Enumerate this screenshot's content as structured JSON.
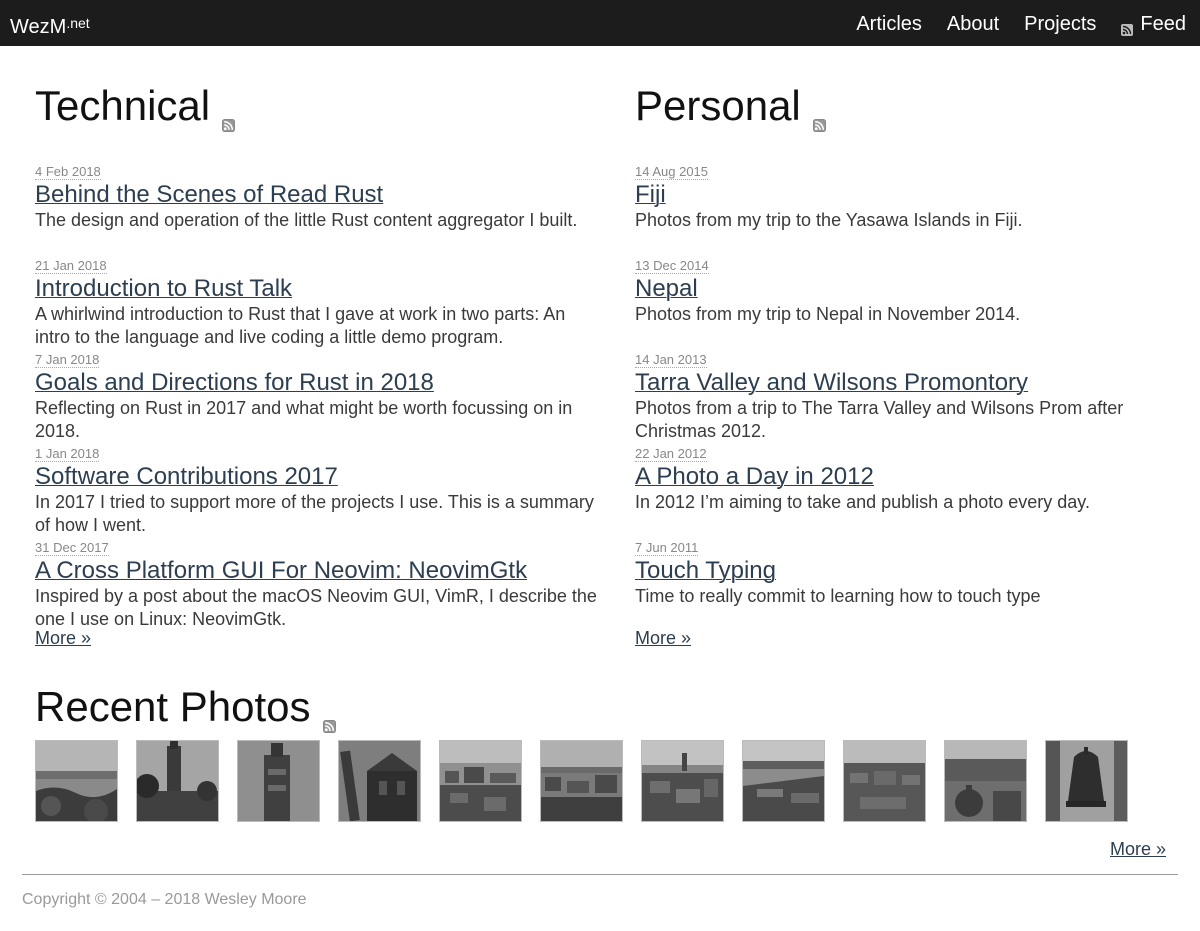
{
  "header": {
    "brand": "WezM",
    "brand_sup": ".net",
    "nav": [
      {
        "label": "Articles"
      },
      {
        "label": "About"
      },
      {
        "label": "Projects"
      },
      {
        "label": "Feed",
        "icon": "rss-icon"
      }
    ]
  },
  "technical": {
    "title": "Technical",
    "icon": "rss-icon",
    "items": [
      {
        "date": "4 Feb 2018",
        "title": "Behind the Scenes of Read Rust",
        "desc": "The design and operation of the little Rust content aggregator I built."
      },
      {
        "date": "21 Jan 2018",
        "title": "Introduction to Rust Talk",
        "desc": "A whirlwind introduction to Rust that I gave at work in two parts: An intro to the language and live coding a little demo program."
      },
      {
        "date": "7 Jan 2018",
        "title": "Goals and Directions for Rust in 2018",
        "desc": "Reflecting on Rust in 2017 and what might be worth focussing on in 2018."
      },
      {
        "date": "1 Jan 2018",
        "title": "Software Contributions 2017",
        "desc": "In 2017 I tried to support more of the projects I use. This is a summary of how I went."
      },
      {
        "date": "31 Dec 2017",
        "title": "A Cross Platform GUI For Neovim: NeovimGtk",
        "desc": "Inspired by a post about the macOS Neovim GUI, VimR, I describe the one I use on Linux: NeovimGtk."
      }
    ],
    "more": "More »"
  },
  "personal": {
    "title": "Personal",
    "icon": "rss-icon",
    "items": [
      {
        "date": "14 Aug 2015",
        "title": "Fiji",
        "desc": "Photos from my trip to the Yasawa Islands in Fiji."
      },
      {
        "date": "13 Dec 2014",
        "title": "Nepal",
        "desc": "Photos from my trip to Nepal in November 2014."
      },
      {
        "date": "14 Jan 2013",
        "title": "Tarra Valley and Wilsons Promontory",
        "desc": "Photos from a trip to The Tarra Valley and Wilsons Prom after Christmas 2012."
      },
      {
        "date": "22 Jan 2012",
        "title": "A Photo a Day in 2012",
        "desc": "In 2012 I’m aiming to take and publish a photo every day."
      },
      {
        "date": "7 Jun 2011",
        "title": "Touch Typing",
        "desc": "Time to really commit to learning how to touch type"
      }
    ],
    "more": "More »"
  },
  "photos": {
    "title": "Recent Photos",
    "icon": "rss-icon",
    "thumbnails": [
      {
        "subject": "coastline"
      },
      {
        "subject": "tower"
      },
      {
        "subject": "tower"
      },
      {
        "subject": "cathedral"
      },
      {
        "subject": "city-rooftops"
      },
      {
        "subject": "city-rooftops"
      },
      {
        "subject": "city-rooftops"
      },
      {
        "subject": "city-rooftops"
      },
      {
        "subject": "city-rooftops"
      },
      {
        "subject": "city-rooftops"
      },
      {
        "subject": "bell"
      }
    ],
    "more": "More »"
  },
  "footer": {
    "copyright": "Copyright © 2004 – 2018 Wesley Moore"
  }
}
